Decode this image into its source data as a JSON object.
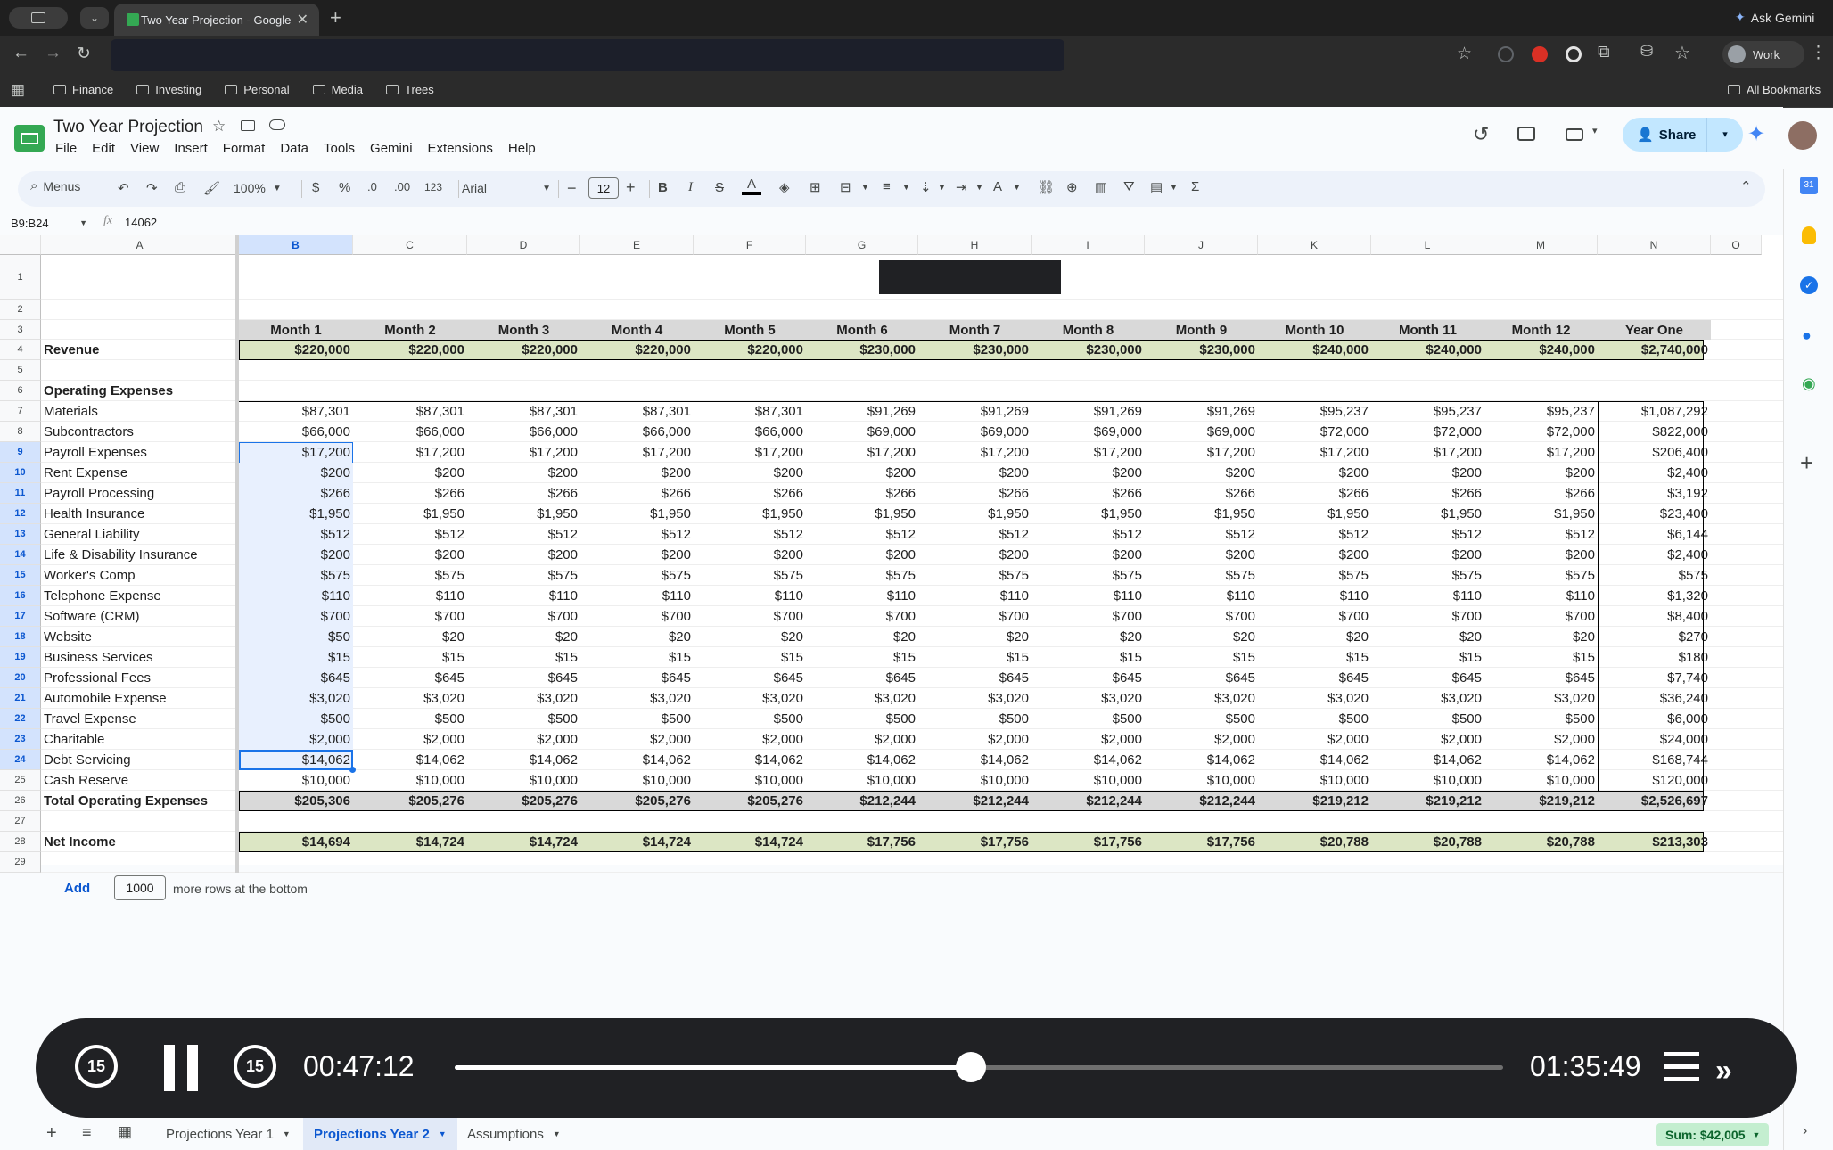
{
  "browser": {
    "tab_title": "Two Year Projection - Google",
    "ask_gemini": "Ask Gemini",
    "profile": "Work",
    "bookmarks": [
      "Finance",
      "Investing",
      "Personal",
      "Media",
      "Trees"
    ],
    "all_bookmarks": "All Bookmarks"
  },
  "sheet": {
    "title": "Two Year Projection",
    "menus": [
      "File",
      "Edit",
      "View",
      "Insert",
      "Format",
      "Data",
      "Tools",
      "Gemini",
      "Extensions",
      "Help"
    ],
    "share_label": "Share",
    "toolbar": {
      "search_menus": "Menus",
      "zoom": "100%",
      "currency": "$",
      "percent": "%",
      "dec_decrease": ".0",
      "dec_increase": ".00",
      "number_format": "123",
      "font": "Arial",
      "font_size": "12"
    },
    "name_box": "B9:B24",
    "formula_value": "14062",
    "columns": [
      "A",
      "B",
      "C",
      "D",
      "E",
      "F",
      "G",
      "H",
      "I",
      "J",
      "K",
      "L",
      "M",
      "N",
      "O"
    ],
    "header_row": [
      "Month 1",
      "Month 2",
      "Month 3",
      "Month 4",
      "Month 5",
      "Month 6",
      "Month 7",
      "Month 8",
      "Month 9",
      "Month 10",
      "Month 11",
      "Month 12",
      "Year One"
    ],
    "rows": [
      {
        "n": "1",
        "label": "",
        "values": []
      },
      {
        "n": "2",
        "label": "",
        "values": []
      },
      {
        "n": "3",
        "label": "",
        "values": []
      },
      {
        "n": "4",
        "label": "Revenue",
        "values": [
          "$220,000",
          "$220,000",
          "$220,000",
          "$220,000",
          "$220,000",
          "$230,000",
          "$230,000",
          "$230,000",
          "$230,000",
          "$240,000",
          "$240,000",
          "$240,000",
          "$2,740,000"
        ]
      },
      {
        "n": "5",
        "label": "",
        "values": []
      },
      {
        "n": "6",
        "label": "Operating Expenses",
        "values": []
      },
      {
        "n": "7",
        "label": "Materials",
        "values": [
          "$87,301",
          "$87,301",
          "$87,301",
          "$87,301",
          "$87,301",
          "$91,269",
          "$91,269",
          "$91,269",
          "$91,269",
          "$95,237",
          "$95,237",
          "$95,237",
          "$1,087,292"
        ]
      },
      {
        "n": "8",
        "label": "Subcontractors",
        "values": [
          "$66,000",
          "$66,000",
          "$66,000",
          "$66,000",
          "$66,000",
          "$69,000",
          "$69,000",
          "$69,000",
          "$69,000",
          "$72,000",
          "$72,000",
          "$72,000",
          "$822,000"
        ]
      },
      {
        "n": "9",
        "label": "Payroll Expenses",
        "values": [
          "$17,200",
          "$17,200",
          "$17,200",
          "$17,200",
          "$17,200",
          "$17,200",
          "$17,200",
          "$17,200",
          "$17,200",
          "$17,200",
          "$17,200",
          "$17,200",
          "$206,400"
        ]
      },
      {
        "n": "10",
        "label": "Rent Expense",
        "values": [
          "$200",
          "$200",
          "$200",
          "$200",
          "$200",
          "$200",
          "$200",
          "$200",
          "$200",
          "$200",
          "$200",
          "$200",
          "$2,400"
        ]
      },
      {
        "n": "11",
        "label": "Payroll Processing",
        "values": [
          "$266",
          "$266",
          "$266",
          "$266",
          "$266",
          "$266",
          "$266",
          "$266",
          "$266",
          "$266",
          "$266",
          "$266",
          "$3,192"
        ]
      },
      {
        "n": "12",
        "label": "Health Insurance",
        "values": [
          "$1,950",
          "$1,950",
          "$1,950",
          "$1,950",
          "$1,950",
          "$1,950",
          "$1,950",
          "$1,950",
          "$1,950",
          "$1,950",
          "$1,950",
          "$1,950",
          "$23,400"
        ]
      },
      {
        "n": "13",
        "label": "General Liability",
        "values": [
          "$512",
          "$512",
          "$512",
          "$512",
          "$512",
          "$512",
          "$512",
          "$512",
          "$512",
          "$512",
          "$512",
          "$512",
          "$6,144"
        ]
      },
      {
        "n": "14",
        "label": "Life & Disability Insurance",
        "values": [
          "$200",
          "$200",
          "$200",
          "$200",
          "$200",
          "$200",
          "$200",
          "$200",
          "$200",
          "$200",
          "$200",
          "$200",
          "$2,400"
        ]
      },
      {
        "n": "15",
        "label": "Worker's Comp",
        "values": [
          "$575",
          "$575",
          "$575",
          "$575",
          "$575",
          "$575",
          "$575",
          "$575",
          "$575",
          "$575",
          "$575",
          "$575",
          "$575"
        ]
      },
      {
        "n": "16",
        "label": "Telephone Expense",
        "values": [
          "$110",
          "$110",
          "$110",
          "$110",
          "$110",
          "$110",
          "$110",
          "$110",
          "$110",
          "$110",
          "$110",
          "$110",
          "$1,320"
        ]
      },
      {
        "n": "17",
        "label": "Software (CRM)",
        "values": [
          "$700",
          "$700",
          "$700",
          "$700",
          "$700",
          "$700",
          "$700",
          "$700",
          "$700",
          "$700",
          "$700",
          "$700",
          "$8,400"
        ]
      },
      {
        "n": "18",
        "label": "Website",
        "values": [
          "$50",
          "$20",
          "$20",
          "$20",
          "$20",
          "$20",
          "$20",
          "$20",
          "$20",
          "$20",
          "$20",
          "$20",
          "$270"
        ]
      },
      {
        "n": "19",
        "label": "Business Services",
        "values": [
          "$15",
          "$15",
          "$15",
          "$15",
          "$15",
          "$15",
          "$15",
          "$15",
          "$15",
          "$15",
          "$15",
          "$15",
          "$180"
        ]
      },
      {
        "n": "20",
        "label": "Professional Fees",
        "values": [
          "$645",
          "$645",
          "$645",
          "$645",
          "$645",
          "$645",
          "$645",
          "$645",
          "$645",
          "$645",
          "$645",
          "$645",
          "$7,740"
        ]
      },
      {
        "n": "21",
        "label": "Automobile Expense",
        "values": [
          "$3,020",
          "$3,020",
          "$3,020",
          "$3,020",
          "$3,020",
          "$3,020",
          "$3,020",
          "$3,020",
          "$3,020",
          "$3,020",
          "$3,020",
          "$3,020",
          "$36,240"
        ]
      },
      {
        "n": "22",
        "label": "Travel Expense",
        "values": [
          "$500",
          "$500",
          "$500",
          "$500",
          "$500",
          "$500",
          "$500",
          "$500",
          "$500",
          "$500",
          "$500",
          "$500",
          "$6,000"
        ]
      },
      {
        "n": "23",
        "label": "Charitable",
        "values": [
          "$2,000",
          "$2,000",
          "$2,000",
          "$2,000",
          "$2,000",
          "$2,000",
          "$2,000",
          "$2,000",
          "$2,000",
          "$2,000",
          "$2,000",
          "$2,000",
          "$24,000"
        ]
      },
      {
        "n": "24",
        "label": "Debt Servicing",
        "values": [
          "$14,062",
          "$14,062",
          "$14,062",
          "$14,062",
          "$14,062",
          "$14,062",
          "$14,062",
          "$14,062",
          "$14,062",
          "$14,062",
          "$14,062",
          "$14,062",
          "$168,744"
        ]
      },
      {
        "n": "25",
        "label": "Cash Reserve",
        "values": [
          "$10,000",
          "$10,000",
          "$10,000",
          "$10,000",
          "$10,000",
          "$10,000",
          "$10,000",
          "$10,000",
          "$10,000",
          "$10,000",
          "$10,000",
          "$10,000",
          "$120,000"
        ]
      },
      {
        "n": "26",
        "label": "Total Operating Expenses",
        "values": [
          "$205,306",
          "$205,276",
          "$205,276",
          "$205,276",
          "$205,276",
          "$212,244",
          "$212,244",
          "$212,244",
          "$212,244",
          "$219,212",
          "$219,212",
          "$219,212",
          "$2,526,697"
        ]
      },
      {
        "n": "27",
        "label": "",
        "values": []
      },
      {
        "n": "28",
        "label": "Net Income",
        "values": [
          "$14,694",
          "$14,724",
          "$14,724",
          "$14,724",
          "$14,724",
          "$17,756",
          "$17,756",
          "$17,756",
          "$17,756",
          "$20,788",
          "$20,788",
          "$20,788",
          "$213,303"
        ]
      },
      {
        "n": "29",
        "label": "",
        "values": []
      }
    ],
    "add_rows": {
      "button": "Add",
      "count": "1000",
      "suffix": "more rows at the bottom"
    },
    "sheet_tabs": [
      "Projections Year 1",
      "Projections Year 2",
      "Assumptions"
    ],
    "active_tab_index": 1,
    "sum_badge": "Sum: $42,005"
  },
  "player": {
    "skip_back": "15",
    "skip_forward": "15",
    "elapsed": "00:47:12",
    "total": "01:35:49",
    "progress": 0.492
  },
  "colors": {
    "accent_blue": "#0b57d0",
    "selection_fill": "#e8f0fe",
    "revenue_row_fill": "#dce6c4",
    "header_row_fill": "#d9d9d9",
    "sum_badge_fill": "#c4eed0"
  }
}
